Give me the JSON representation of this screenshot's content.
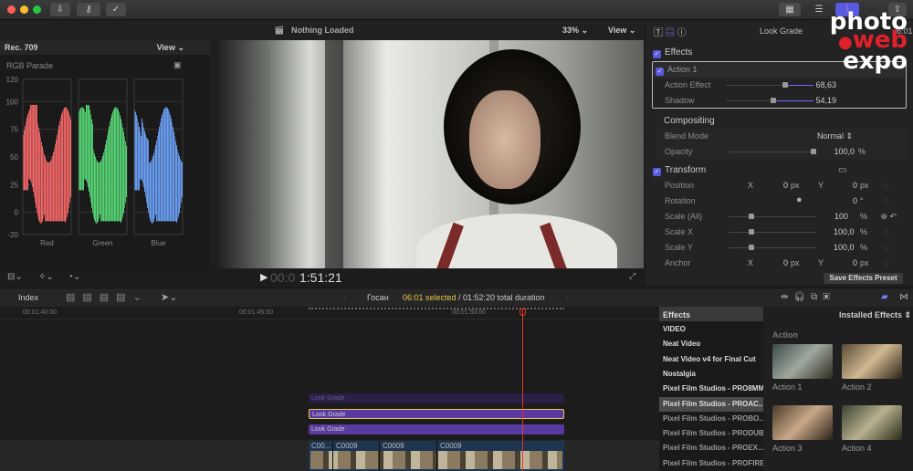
{
  "window": {
    "traffic_lights": [
      "#ff5f57",
      "#ffbd2e",
      "#28c940"
    ],
    "toolbar_icons": [
      "download-icon",
      "key-icon",
      "checkmark-icon"
    ],
    "right_icons": [
      "grid-icon",
      "list-icon",
      "sliders-icon",
      "share-icon"
    ]
  },
  "scopes": {
    "standard": "Rec. 709",
    "view_label": "View",
    "title": "RGB Parade",
    "y_ticks": [
      "120",
      "100",
      "75",
      "50",
      "25",
      "0",
      "-20"
    ],
    "channels": [
      {
        "label": "Red",
        "color": "#ff6b6b"
      },
      {
        "label": "Green",
        "color": "#5ae07a"
      },
      {
        "label": "Blue",
        "color": "#6fa6ff"
      }
    ]
  },
  "viewer": {
    "status": "Nothing Loaded",
    "zoom": "33%",
    "view_label": "View",
    "timecode_dim": "00:0",
    "timecode": "1:51:21"
  },
  "inspector": {
    "title": "Look Grade",
    "duration_partial": "6:01",
    "effects_label": "Effects",
    "action_label": "Action 1",
    "params": [
      {
        "label": "Action Effect",
        "value": "68,63",
        "fraction": 0.68
      },
      {
        "label": "Shadow",
        "value": "54,19",
        "fraction": 0.54
      }
    ],
    "compositing": {
      "label": "Compositing",
      "blend_label": "Blend Mode",
      "blend_value": "Normal",
      "opacity_label": "Opacity",
      "opacity_value": "100,0",
      "opacity_unit": "%"
    },
    "transform": {
      "label": "Transform",
      "position_label": "Position",
      "x": "X",
      "y": "Y",
      "pos_x": "0",
      "pos_y": "0",
      "px": "px",
      "rotation_label": "Rotation",
      "rotation_value": "0",
      "rotation_unit": "°",
      "scale_all_label": "Scale (All)",
      "scale_all_value": "100",
      "scale_x_label": "Scale X",
      "scale_x_value": "100,0",
      "scale_y_label": "Scale Y",
      "scale_y_value": "100,0",
      "pct": "%",
      "anchor_label": "Anchor",
      "anchor_x": "0",
      "anchor_y": "0"
    },
    "save_preset": "Save Effects Preset"
  },
  "timeline_bar": {
    "index": "Index",
    "project": "Госан",
    "selected": "06:01 selected",
    "total": "/ 01:52:20 total duration"
  },
  "timeline": {
    "ruler": [
      "00:01:40:00",
      "00:01:45:00",
      "00:01:50:00"
    ],
    "clips": [
      "Look Grade",
      "Look Grade",
      "Look Grade"
    ],
    "video_clips": [
      "C00...",
      "C0009",
      "C0009",
      "C0009"
    ]
  },
  "browser": {
    "header": "Effects",
    "installed": "Installed Effects",
    "categories": [
      "VIDEO",
      "Neat Video",
      "Neat Video v4 for Final Cut",
      "Nostalgia",
      "Pixel Film Studios - PRO8MM",
      "Pixel Film Studios - PROAC...",
      "Pixel Film Studios - PROBO...",
      "Pixel Film Studios - PRODUB",
      "Pixel Film Studios - PROEX...",
      "Pixel Film Studios - PROFIRE"
    ],
    "selected_index": 5,
    "group": "Action",
    "effects": [
      "Action 1",
      "Action 2",
      "Action 3",
      "Action 4"
    ]
  },
  "watermark": {
    "line1": "photo",
    "line2": "web",
    "line3": "expo"
  }
}
